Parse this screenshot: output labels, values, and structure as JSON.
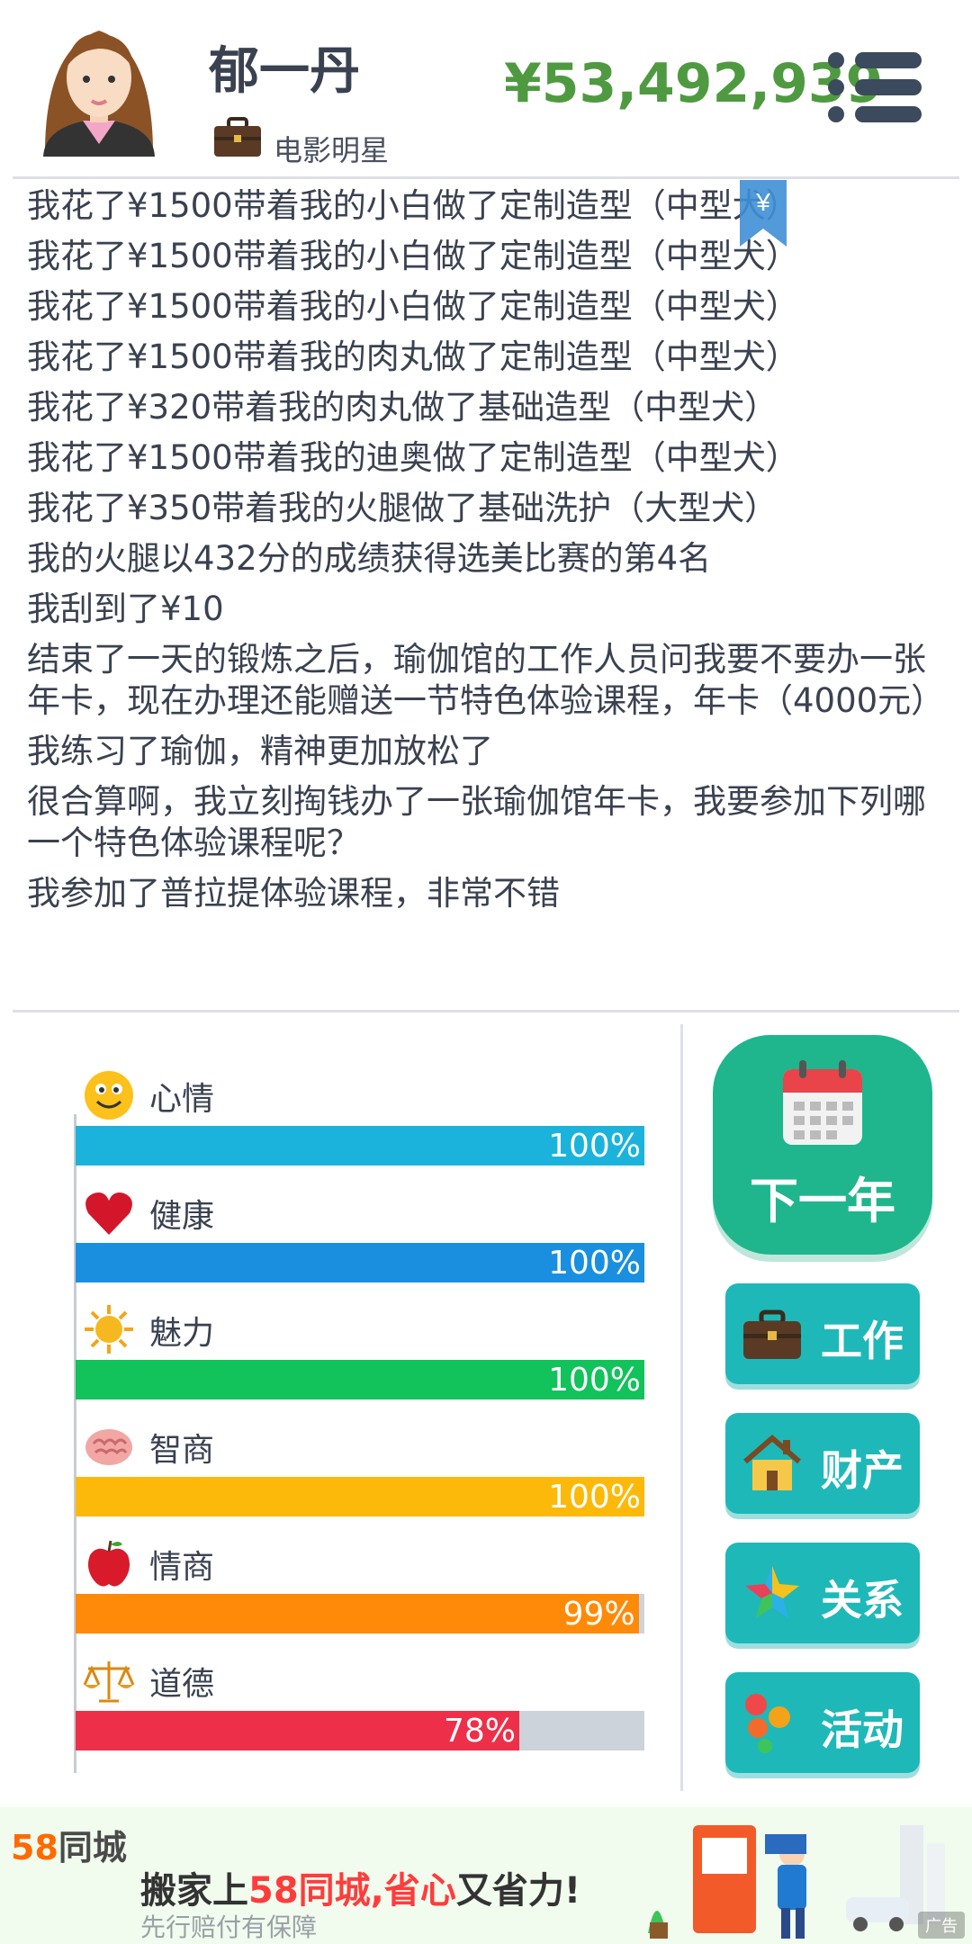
{
  "profile": {
    "name": "郁一丹",
    "job": "电影明星",
    "money": "¥53,492,939"
  },
  "log_marker": "¥",
  "log": [
    "我花了¥1500带着我的小白做了定制造型（中型犬）",
    "我花了¥1500带着我的小白做了定制造型（中型犬）",
    "我花了¥1500带着我的小白做了定制造型（中型犬）",
    "我花了¥1500带着我的肉丸做了定制造型（中型犬）",
    "我花了¥320带着我的肉丸做了基础造型（中型犬）",
    "我花了¥1500带着我的迪奥做了定制造型（中型犬）",
    "我花了¥350带着我的火腿做了基础洗护（大型犬）",
    "我的火腿以432分的成绩获得选美比赛的第4名",
    "我刮到了¥10",
    "结束了一天的锻炼之后，瑜伽馆的工作人员问我要不要办一张年卡，现在办理还能赠送一节特色体验课程，年卡（4000元）",
    "我练习了瑜伽，精神更加放松了",
    "很合算啊，我立刻掏钱办了一张瑜伽馆年卡，我要参加下列哪一个特色体验课程呢？",
    "我参加了普拉提体验课程，非常不错"
  ],
  "stats": [
    {
      "label": "心情",
      "value": 100,
      "text": "100%",
      "color": "#1bb3dc",
      "icon": "smiley-icon"
    },
    {
      "label": "健康",
      "value": 100,
      "text": "100%",
      "color": "#1a8fe0",
      "icon": "heart-icon"
    },
    {
      "label": "魅力",
      "value": 100,
      "text": "100%",
      "color": "#12c25a",
      "icon": "sun-icon"
    },
    {
      "label": "智商",
      "value": 100,
      "text": "100%",
      "color": "#fcb90a",
      "icon": "brain-icon"
    },
    {
      "label": "情商",
      "value": 99,
      "text": "99%",
      "color": "#ff8a0a",
      "icon": "apple-icon"
    },
    {
      "label": "道德",
      "value": 78,
      "text": "78%",
      "color": "#ee2f49",
      "icon": "scales-icon"
    }
  ],
  "buttons": {
    "next_year": "下一年",
    "work": "工作",
    "assets": "财产",
    "relations": "关系",
    "activities": "活动"
  },
  "ad": {
    "logo_num": "58",
    "logo_text": "同城",
    "headline_a": "搬家上",
    "headline_b": "58同城,省心",
    "headline_c": "又省力!",
    "sub": "先行赔付有保障",
    "tag": "广告"
  }
}
